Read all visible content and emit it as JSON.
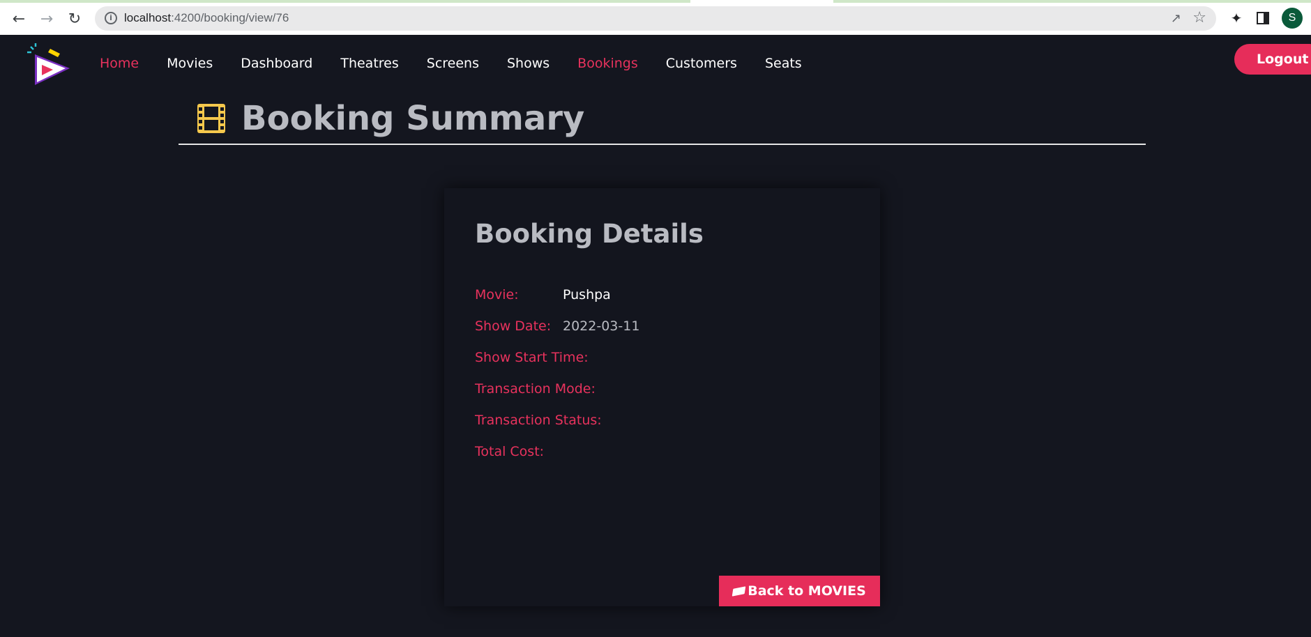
{
  "browser": {
    "url_host": "localhost",
    "url_path": ":4200/booking/view/76",
    "avatar_initial": "S"
  },
  "nav": {
    "items": [
      {
        "label": "Home",
        "active": true
      },
      {
        "label": "Movies",
        "active": false
      },
      {
        "label": "Dashboard",
        "active": false
      },
      {
        "label": "Theatres",
        "active": false
      },
      {
        "label": "Screens",
        "active": false
      },
      {
        "label": "Shows",
        "active": false
      },
      {
        "label": "Bookings",
        "active": true
      },
      {
        "label": "Customers",
        "active": false
      },
      {
        "label": "Seats",
        "active": false
      }
    ],
    "logout_label": "Logout"
  },
  "summary": {
    "title": "Booking Summary"
  },
  "card": {
    "title": "Booking Details",
    "rows": [
      {
        "label": "Movie:",
        "value": "Pushpa"
      },
      {
        "label": "Show Date:",
        "value": "2022-03-11"
      },
      {
        "label": "Show Start Time:",
        "value": ""
      },
      {
        "label": "Transaction Mode:",
        "value": ""
      },
      {
        "label": "Transaction Status:",
        "value": ""
      },
      {
        "label": "Total Cost:",
        "value": ""
      }
    ],
    "back_label": "Back to MOVIES"
  },
  "colors": {
    "accent": "#e62d5a",
    "background": "#14161f",
    "icon_yellow": "#f5c84c"
  },
  "icons": {
    "logo": "play-logo",
    "summary": "film-strip-icon",
    "back": "ticket-icon"
  }
}
